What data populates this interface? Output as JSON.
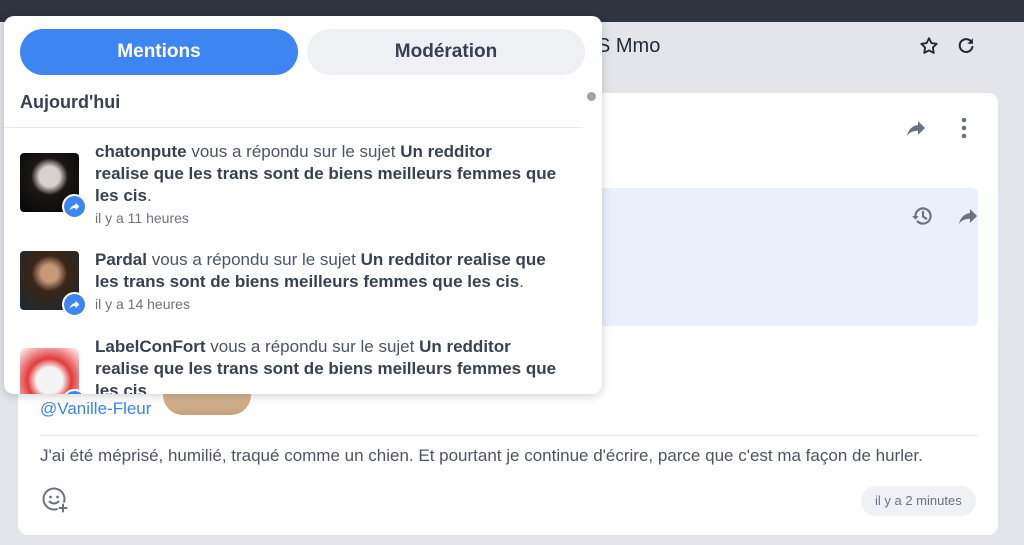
{
  "header": {
    "title": "S Mmo"
  },
  "tabs": [
    {
      "label": "Mentions",
      "active": true
    },
    {
      "label": "Modération",
      "active": false
    }
  ],
  "section_label": "Aujourd'hui",
  "notifications": [
    {
      "user": "chatonpute",
      "action": "vous a répondu sur le sujet",
      "subject_line1": "Un redditor",
      "subject_rest": "realise que les trans sont de biens meilleurs femmes que les cis",
      "suffix": ".",
      "time": "il y a 11 heures"
    },
    {
      "user": "Pardal",
      "action": "vous a répondu sur le sujet",
      "subject_line1": "Un redditor realise que",
      "subject_rest": "les trans sont de biens meilleurs femmes que les cis",
      "suffix": ".",
      "time": "il y a 14 heures"
    },
    {
      "user": "LabelConFort",
      "action": "vous a répondu sur le sujet",
      "subject_line1": "Un redditor",
      "subject_rest": "realise que les trans sont de biens meilleurs femmes que les cis",
      "suffix": ".",
      "time": ""
    }
  ],
  "post": {
    "mention": "@Vanille-Fleur",
    "signature": "J'ai été méprisé, humilié, traqué comme un chien. Et pourtant je continue d'écrire, parce que c'est ma façon de hurler.",
    "time": "il y a 2 minutes"
  },
  "icons": [
    "star-icon",
    "refresh-icon",
    "share-icon",
    "more-vertical-icon",
    "history-icon",
    "reply-icon",
    "emoji-add-icon"
  ],
  "colors": {
    "accent": "#3d86f2",
    "link": "#3b82f6"
  }
}
